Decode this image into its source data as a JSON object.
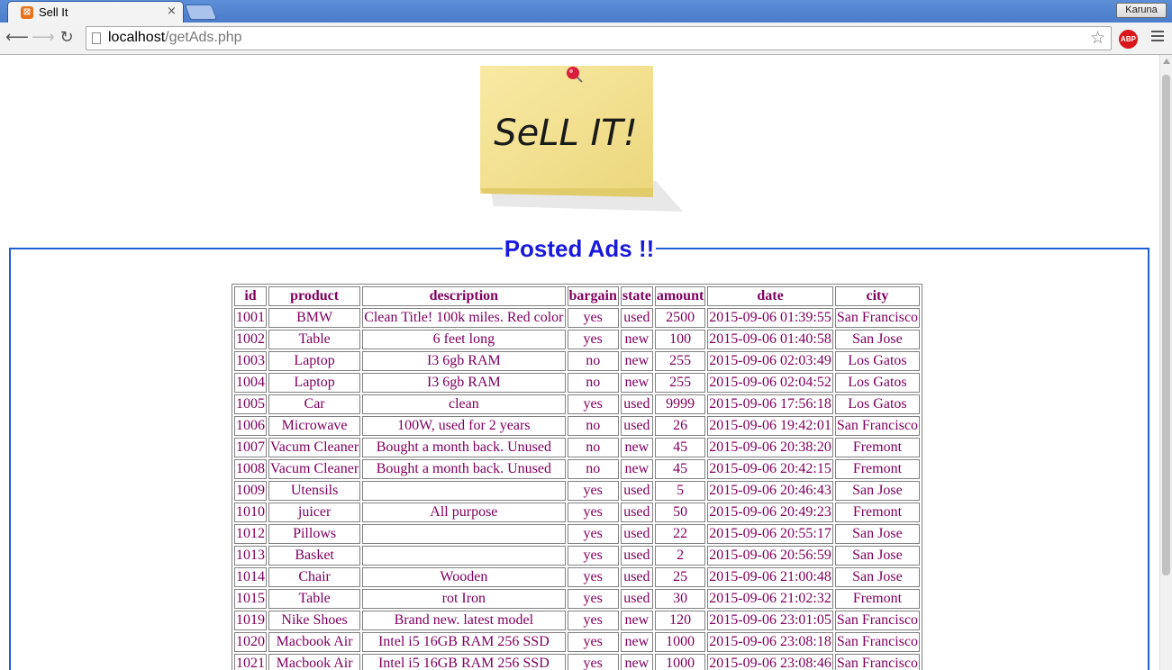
{
  "browser": {
    "tab_title": "Sell It",
    "tab_close": "×",
    "profile_name": "Karuna",
    "url_host": "localhost",
    "url_path": "/getAds.php",
    "extension_label": "ABP"
  },
  "logo": {
    "text": "SeLL IT!"
  },
  "legend": "Posted Ads !!",
  "table": {
    "headers": [
      "id",
      "product",
      "description",
      "bargain",
      "state",
      "amount",
      "date",
      "city"
    ],
    "rows": [
      [
        "1001",
        "BMW",
        "Clean Title! 100k miles. Red color",
        "yes",
        "used",
        "2500",
        "2015-09-06 01:39:55",
        "San Francisco"
      ],
      [
        "1002",
        "Table",
        "6 feet long",
        "yes",
        "new",
        "100",
        "2015-09-06 01:40:58",
        "San Jose"
      ],
      [
        "1003",
        "Laptop",
        "I3 6gb RAM",
        "no",
        "new",
        "255",
        "2015-09-06 02:03:49",
        "Los Gatos"
      ],
      [
        "1004",
        "Laptop",
        "I3 6gb RAM",
        "no",
        "new",
        "255",
        "2015-09-06 02:04:52",
        "Los Gatos"
      ],
      [
        "1005",
        "Car",
        "clean",
        "yes",
        "used",
        "9999",
        "2015-09-06 17:56:18",
        "Los Gatos"
      ],
      [
        "1006",
        "Microwave",
        "100W, used for 2 years",
        "no",
        "used",
        "26",
        "2015-09-06 19:42:01",
        "San Francisco"
      ],
      [
        "1007",
        "Vacum Cleaner",
        "Bought a month back. Unused",
        "no",
        "new",
        "45",
        "2015-09-06 20:38:20",
        "Fremont"
      ],
      [
        "1008",
        "Vacum Cleaner",
        "Bought a month back. Unused",
        "no",
        "new",
        "45",
        "2015-09-06 20:42:15",
        "Fremont"
      ],
      [
        "1009",
        "Utensils",
        "",
        "yes",
        "used",
        "5",
        "2015-09-06 20:46:43",
        "San Jose"
      ],
      [
        "1010",
        "juicer",
        "All purpose",
        "yes",
        "used",
        "50",
        "2015-09-06 20:49:23",
        "Fremont"
      ],
      [
        "1012",
        "Pillows",
        "",
        "yes",
        "used",
        "22",
        "2015-09-06 20:55:17",
        "San Jose"
      ],
      [
        "1013",
        "Basket",
        "",
        "yes",
        "used",
        "2",
        "2015-09-06 20:56:59",
        "San Jose"
      ],
      [
        "1014",
        "Chair",
        "Wooden",
        "yes",
        "used",
        "25",
        "2015-09-06 21:00:48",
        "San Jose"
      ],
      [
        "1015",
        "Table",
        "rot Iron",
        "yes",
        "used",
        "30",
        "2015-09-06 21:02:32",
        "Fremont"
      ],
      [
        "1019",
        "Nike Shoes",
        "Brand new. latest model",
        "yes",
        "new",
        "120",
        "2015-09-06 23:01:05",
        "San Francisco"
      ],
      [
        "1020",
        "Macbook Air",
        "Intel i5 16GB RAM 256 SSD",
        "yes",
        "new",
        "1000",
        "2015-09-06 23:08:18",
        "San Francisco"
      ],
      [
        "1021",
        "Macbook Air",
        "Intel i5 16GB RAM 256 SSD",
        "yes",
        "new",
        "1000",
        "2015-09-06 23:08:46",
        "San Francisco"
      ]
    ]
  }
}
